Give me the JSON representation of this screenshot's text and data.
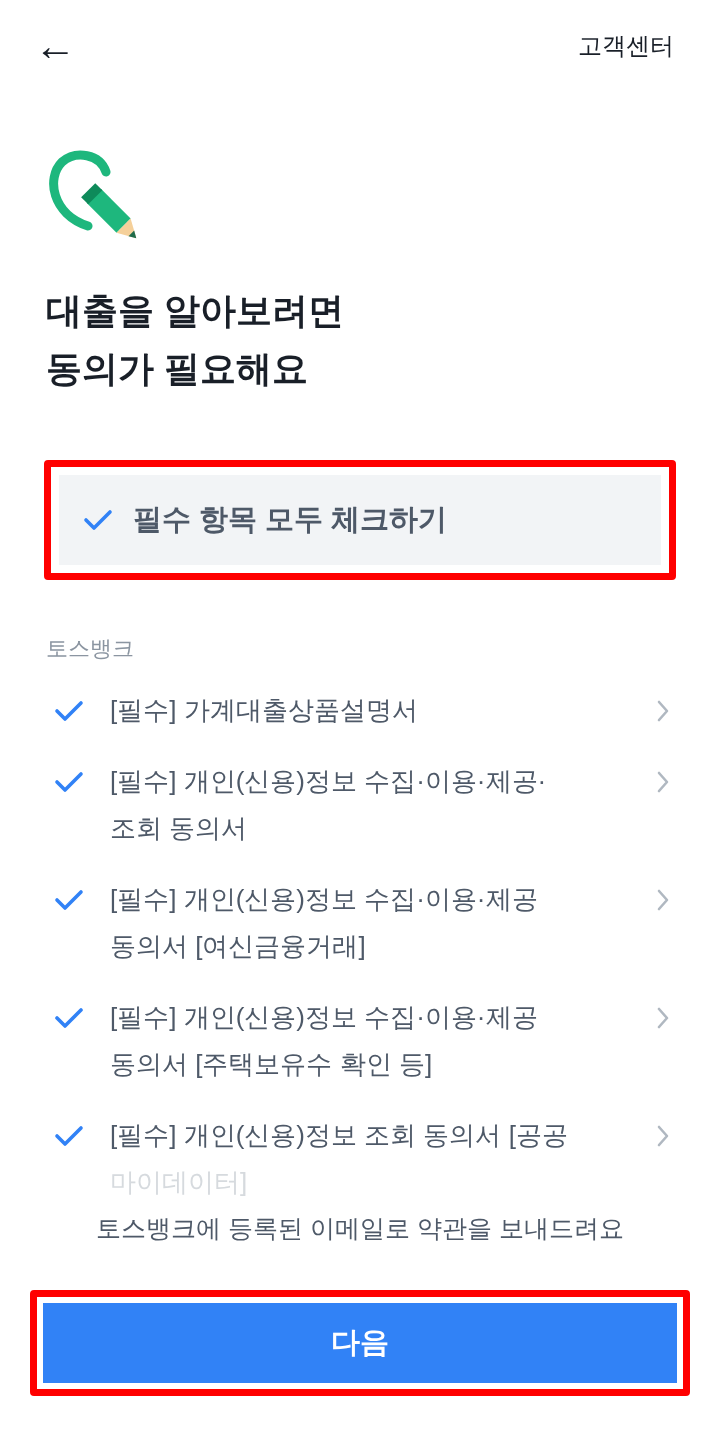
{
  "header": {
    "back": "←",
    "help_link": "고객센터"
  },
  "title_lines": [
    "대출을 알아보려면",
    "동의가 필요해요"
  ],
  "check_all": {
    "label": "필수 항목 모두 체크하기",
    "checked": true,
    "highlighted": true
  },
  "section_label": "토스뱅크",
  "items": [
    {
      "lines": [
        "[필수] 가계대출상품설명서"
      ],
      "checked": true,
      "faded_last_line": false
    },
    {
      "lines": [
        "[필수] 개인(신용)정보 수집·이용·제공·",
        "조회 동의서"
      ],
      "checked": true,
      "faded_last_line": false
    },
    {
      "lines": [
        "[필수] 개인(신용)정보 수집·이용·제공",
        "동의서 [여신금융거래]"
      ],
      "checked": true,
      "faded_last_line": false
    },
    {
      "lines": [
        "[필수] 개인(신용)정보 수집·이용·제공",
        "동의서 [주택보유수 확인 등]"
      ],
      "checked": true,
      "faded_last_line": false
    },
    {
      "lines": [
        "[필수] 개인(신용)정보 조회 동의서 [공공",
        "마이데이터]"
      ],
      "checked": true,
      "faded_last_line": true
    }
  ],
  "footer_note": "토스뱅크에 등록된 이메일로 약관을 보내드려요",
  "next_button": {
    "label": "다음",
    "highlighted": true
  }
}
